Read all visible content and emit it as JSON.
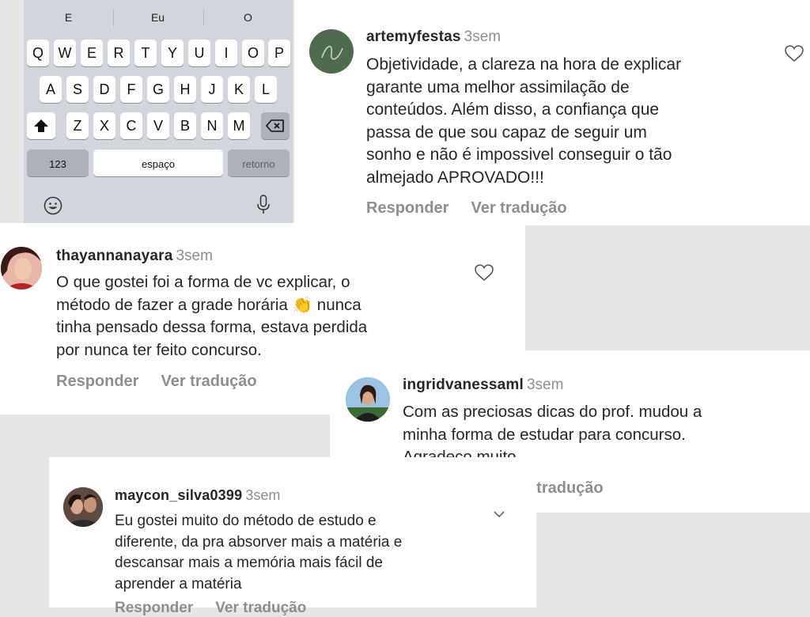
{
  "keyboard": {
    "suggestions": [
      "E",
      "Eu",
      "O"
    ],
    "row1": [
      "Q",
      "W",
      "E",
      "R",
      "T",
      "Y",
      "U",
      "I",
      "O",
      "P"
    ],
    "row2": [
      "A",
      "S",
      "D",
      "F",
      "G",
      "H",
      "J",
      "K",
      "L"
    ],
    "row3": [
      "Z",
      "X",
      "C",
      "V",
      "B",
      "N",
      "M"
    ],
    "shift_icon": "shift-icon",
    "delete_icon": "delete-icon",
    "numbers_label": "123",
    "space_label": "espaço",
    "return_label": "retorno",
    "emoji_icon": "emoji-icon",
    "mic_icon": "microphone-icon"
  },
  "actions": {
    "reply": "Responder",
    "translate": "Ver tradução"
  },
  "comments": [
    {
      "username": "artemyfestas",
      "time": "3sem",
      "text": "Objetividade, a clareza na hora de explicar\ngarante uma melhor assimilação de\nconteúdos. Além disso, a confiança que\npassa de que sou capaz de seguir um\nsonho e não é impossivel conseguir o tão\nalmejado APROVADO!!!",
      "liked": false
    },
    {
      "username": "thayannanayara",
      "time": "3sem",
      "text_before_emoji": "O que gostei foi a forma de vc explicar, o\nmétodo de fazer a grade horária ",
      "emoji": "👏",
      "text_after_emoji": " nunca\ntinha pensado dessa forma, estava perdida\npor nunca ter feito concurso.",
      "liked": false
    },
    {
      "username": "ingridvanessaml",
      "time": "3sem",
      "text": "Com as preciosas dicas do prof. mudou a\nminha forma de estudar para concurso.\nAgradeço muito."
    },
    {
      "username": "maycon_silva0399",
      "time": "3sem",
      "text": "Eu gostei muito do método de estudo e\ndiferente, da pra absorver mais a matéria e\ndescansar mais a memória mais fácil de\naprender a matéria"
    }
  ],
  "colors": {
    "background": "#e6e6e6",
    "card": "#ffffff",
    "text": "#262626",
    "muted": "#8e8e8e",
    "avatar_green": "#4f6a4f"
  }
}
